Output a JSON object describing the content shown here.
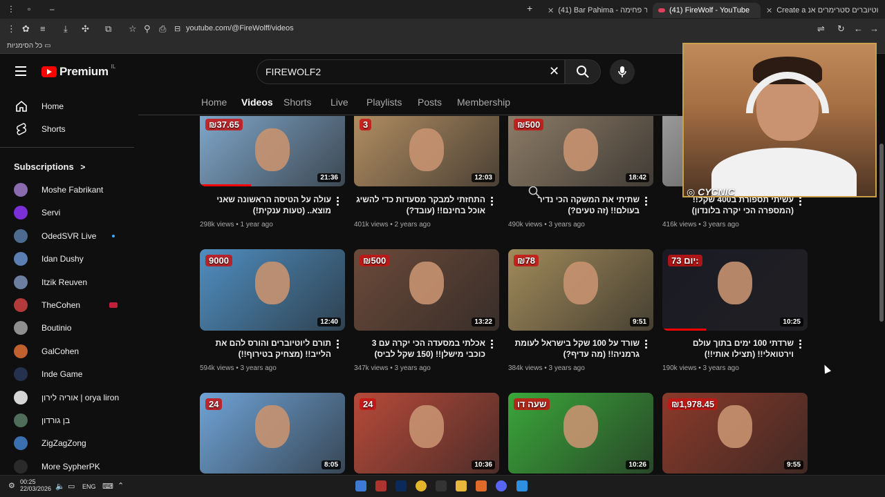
{
  "browser": {
    "tabs": [
      {
        "label": "Create a יוטיוברים סטרימרים אנ",
        "active": false
      },
      {
        "label": "(41) FireWolf - YouTube",
        "active": true
      },
      {
        "label": "(41) Bar Pahima - בר פחימה - Yo",
        "active": false
      }
    ],
    "url": "youtube.com/@FireWolff/videos",
    "bookmarks_all": "כל הסימניות"
  },
  "youtube": {
    "logo_word": "Premium",
    "country": "IL",
    "search_value": "FIREWOLF2",
    "sidebar": {
      "nav": [
        {
          "label": "Home",
          "icon": "home-icon"
        },
        {
          "label": "Shorts",
          "icon": "shorts-icon"
        }
      ],
      "subscriptions_title": "Subscriptions",
      "subscriptions_chevron": ">",
      "subs": [
        {
          "name": "Moshe Fabrikant",
          "color": "#8a6bb0",
          "badge": ""
        },
        {
          "name": "Servi",
          "color": "#7b2fd6",
          "badge": ""
        },
        {
          "name": "OdedSVR Live",
          "color": "#4d6b8f",
          "badge": "dot"
        },
        {
          "name": "Idan Dushy",
          "color": "#5b7fb2",
          "badge": ""
        },
        {
          "name": "Itzik Reuven",
          "color": "#6c7fa0",
          "badge": ""
        },
        {
          "name": "TheCohen",
          "color": "#b23a3a",
          "badge": "live"
        },
        {
          "name": "Boutinio",
          "color": "#8f8f8f",
          "badge": ""
        },
        {
          "name": "GalCohen",
          "color": "#c0612f",
          "badge": ""
        },
        {
          "name": "Inde Game",
          "color": "#24324f",
          "badge": ""
        },
        {
          "name": "אוריה לירון | orya liron",
          "color": "#d6d6d6",
          "badge": ""
        },
        {
          "name": "בן גורדון",
          "color": "#4f6d5a",
          "badge": ""
        },
        {
          "name": "ZigZagZong",
          "color": "#3a6fb0",
          "badge": ""
        },
        {
          "name": "More SypherPK",
          "color": "#2a2a2a",
          "badge": ""
        }
      ]
    },
    "channel_tabs": [
      "Home",
      "Videos",
      "Shorts",
      "Live",
      "Playlists",
      "Posts",
      "Membership"
    ],
    "active_tab": "Videos",
    "videos": [
      {
        "title": "עולה על הטיסה הראשונה שאני מוצא.. (טעות ענקית!)",
        "views": "298k views",
        "age": "1 year ago",
        "duration": "21:36",
        "bg": "#7fa6c9",
        "overlay": "₪37.65",
        "progress": 0.35
      },
      {
        "title": "התחזתי למבקר מסעדות כדי להשיג אוכל בחינם!! (עובד?)",
        "views": "401k views",
        "age": "2 years ago",
        "duration": "12:03",
        "bg": "#b08d62",
        "overlay": "3",
        "progress": 0
      },
      {
        "title": "שתיתי את המשקה הכי נדיר בעולם!! (זה טעים?)",
        "views": "490k views",
        "age": "3 years ago",
        "duration": "18:42",
        "bg": "#8c7b66",
        "overlay": "₪500",
        "progress": 0
      },
      {
        "title": "עשיתי תספורת ב400 שקל!! (המספרה הכי יקרה בלונדון)",
        "views": "416k views",
        "age": "3 years ago",
        "duration": "",
        "bg": "#9a9a9a",
        "overlay": "",
        "progress": 0
      },
      {
        "title": "תורם ליוטיוברים והורס להם את הלייב!! (מצחיק בטירוף!!)",
        "views": "594k views",
        "age": "3 years ago",
        "duration": "12:40",
        "bg": "#4f8ec0",
        "overlay": "9000",
        "progress": 0
      },
      {
        "title": "אכלתי במסעדה הכי יקרה עם 3 כוכבי מישלן!! (150 שקל לביס)",
        "views": "347k views",
        "age": "3 years ago",
        "duration": "13:22",
        "bg": "#6b4a3a",
        "overlay": "₪500",
        "progress": 0
      },
      {
        "title": "שורד על 100 שקל בישראל לעומת גרמניה!! (מה עדיף?)",
        "views": "384k views",
        "age": "3 years ago",
        "duration": "9:51",
        "bg": "#a08a5a",
        "overlay": "₪78",
        "progress": 0
      },
      {
        "title": "שרדתי 100 ימים בתוך עולם וירטואלי!! (תצילו אותי!!)",
        "views": "190k views",
        "age": "3 years ago",
        "duration": "10:25",
        "bg": "#1a1a24",
        "overlay": "יום 73:",
        "progress": 0.3
      },
      {
        "title": "",
        "views": "",
        "age": "",
        "duration": "8:05",
        "bg": "#6fa3d6",
        "overlay": "24",
        "progress": 0
      },
      {
        "title": "",
        "views": "",
        "age": "",
        "duration": "10:36",
        "bg": "#b74a3a",
        "overlay": "24",
        "progress": 0
      },
      {
        "title": "",
        "views": "",
        "age": "",
        "duration": "10:26",
        "bg": "#3aa63a",
        "overlay": "שעה דו",
        "progress": 0
      },
      {
        "title": "",
        "views": "",
        "age": "",
        "duration": "9:55",
        "bg": "#8a3a2a",
        "overlay": "₪1,978.45",
        "progress": 0
      }
    ]
  },
  "webcam": {
    "label": "CYCNIC"
  },
  "taskbar": {
    "time": "00:25",
    "date": "22/03/2026",
    "lang": "ENG"
  }
}
